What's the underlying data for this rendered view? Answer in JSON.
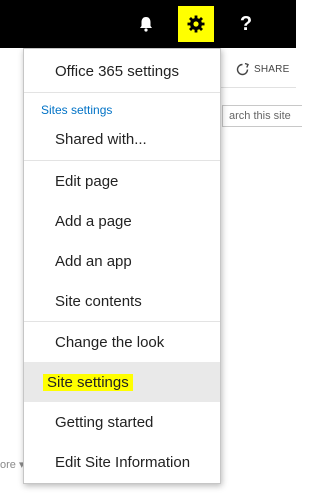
{
  "topbar": {
    "bell_icon": "bell-icon",
    "gear_icon": "gear-icon",
    "help_label": "?"
  },
  "background": {
    "share_label": "SHARE",
    "search_placeholder": "arch this site",
    "more_label": "ore ▾"
  },
  "menu": {
    "office_settings": "Office 365 settings",
    "section_label": "Sites settings",
    "shared_with": "Shared with...",
    "edit_page": "Edit page",
    "add_page": "Add a page",
    "add_app": "Add an app",
    "site_contents": "Site contents",
    "change_look": "Change the look",
    "site_settings": "Site settings",
    "getting_started": "Getting started",
    "edit_site_info": "Edit Site Information"
  },
  "colors": {
    "highlight": "#ffff00",
    "section_blue": "#0072c6",
    "active_bg": "#e9e9e9"
  }
}
